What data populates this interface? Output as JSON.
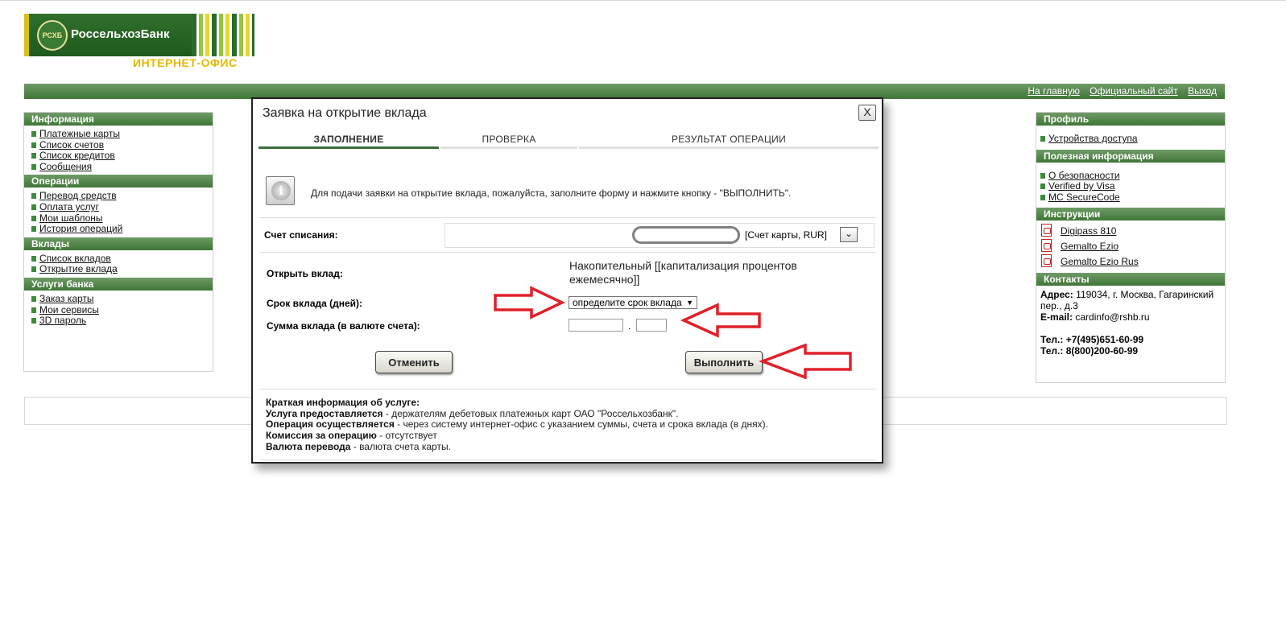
{
  "brand": {
    "bank_name": "РоссельхозБанк",
    "emblem": "РСХБ",
    "office": "ИНТЕРНЕТ-ОФИС"
  },
  "topnav": {
    "home": "На главную",
    "official_site": "Официальный сайт",
    "logout": "Выход"
  },
  "left_sidebar": {
    "info": {
      "title": "Информация",
      "items": [
        "Платежные карты",
        "Список счетов",
        "Список кредитов",
        "Сообщения"
      ]
    },
    "operations": {
      "title": "Операции",
      "items": [
        "Перевод средств",
        "Оплата услуг",
        "Мои шаблоны",
        "История операций"
      ]
    },
    "deposits": {
      "title": "Вклады",
      "items": [
        "Список вкладов",
        "Открытие вклада"
      ]
    },
    "services": {
      "title": "Услуги банка",
      "items": [
        "Заказ карты",
        "Мои сервисы",
        "3D пароль"
      ]
    }
  },
  "right_sidebar": {
    "profile": {
      "title": "Профиль",
      "items": [
        "Устройства доступа"
      ]
    },
    "useful": {
      "title": "Полезная информация",
      "items": [
        "О безопасности",
        "Verified by Visa",
        "MC SecureCode"
      ]
    },
    "instructions": {
      "title": "Инструкции",
      "items": [
        "Digipass 810",
        "Gemalto Ezio",
        "Gemalto Ezio Rus"
      ]
    },
    "contacts": {
      "title": "Контакты",
      "address_label": "Адрес:",
      "address": " 119034, г. Москва, Гагаринский пер., д.3",
      "email_label": "E-mail:",
      "email": " cardinfo@rshb.ru",
      "phone1_label": "Тел.:",
      "phone1": " +7(495)651-60-99",
      "phone2_label": "Тел.:",
      "phone2": "  8(800)200-60-99"
    }
  },
  "modal": {
    "title": "Заявка на открытие вклада",
    "close": "X",
    "steps": [
      "ЗАПОЛНЕНИЕ",
      "ПРОВЕРКА",
      "РЕЗУЛЬТАТ ОПЕРАЦИИ"
    ],
    "info_text": "Для подачи заявки на открытие вклада, пожалуйста, заполните форму и нажмите кнопку - \"ВЫПОЛНИТЬ\".",
    "debit_account_label": "Счет списания:",
    "account_type": "[Счет карты, RUR]",
    "open_deposit_label": "Открыть вклад:",
    "deposit_name": "Накопительный [[капитализация процентов ежемесячно]]",
    "term_label": "Срок вклада (дней):",
    "term_select": "определите срок вклада",
    "amount_label": "Сумма вклада (в валюте счета):",
    "amount_separator": ".",
    "cancel_button": "Отменить",
    "execute_button": "Выполнить",
    "brief": {
      "title": "Краткая информация об услуге:",
      "l1_bold": "Услуга предоставляется",
      "l1": " - держателям дебетовых платежных карт ОАО \"Россельхозбанк\".",
      "l2_bold": "Операция осуществляется",
      "l2": " - через систему интернет-офис с указанием суммы, счета и срока вклада (в днях).",
      "l3_bold": "Комиссия за операцию",
      "l3": " - отсутствует",
      "l4_bold": "Валюта перевода",
      "l4": " - валюта счета карты."
    }
  },
  "colors": {
    "brand_green": "#3f7637",
    "annotation_red": "#e0202a",
    "office_gold": "#e6b800"
  }
}
